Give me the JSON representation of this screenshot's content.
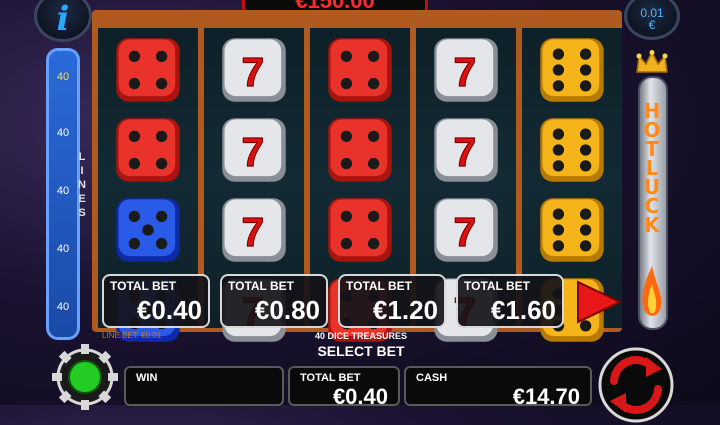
{
  "header": {
    "info_icon": "i",
    "coin_value": "0.01",
    "coin_currency": "€",
    "jackpot": "€150.00"
  },
  "lines_meter": {
    "values": [
      "40",
      "40",
      "40",
      "40",
      "40"
    ],
    "label": "LINES"
  },
  "reels": [
    [
      "red",
      "red",
      "blue",
      "blue"
    ],
    [
      "silver-seven",
      "silver-seven",
      "silver-seven",
      "silver-seven"
    ],
    [
      "red",
      "red",
      "red",
      "red"
    ],
    [
      "silver-seven",
      "silver-seven",
      "silver-seven",
      "silver-seven"
    ],
    [
      "gold",
      "gold",
      "gold",
      "gold"
    ]
  ],
  "hot_luck": {
    "text": "HOT LUCK"
  },
  "bet_options": [
    {
      "label": "TOTAL BET",
      "amount": "€0.40"
    },
    {
      "label": "TOTAL BET",
      "amount": "€0.80"
    },
    {
      "label": "TOTAL BET",
      "amount": "€1.20"
    },
    {
      "label": "TOTAL BET",
      "amount": "€1.60"
    }
  ],
  "line_bet": "LINE BET: €0.01",
  "game_name": "40 DICE TREASURES",
  "select_bet": "SELECT BET",
  "bottom": {
    "win_label": "WIN",
    "win_value": "",
    "total_bet_label": "TOTAL BET",
    "total_bet_value": "€0.40",
    "cash_label": "CASH",
    "cash_value": "€14.70"
  },
  "colors": {
    "frame": "#b05a20",
    "jackpot_text": "#ff2a2a",
    "hot_luck": "#ff8a1a",
    "settings_light": "#22cc22",
    "spin_arrows": "#d81818"
  }
}
